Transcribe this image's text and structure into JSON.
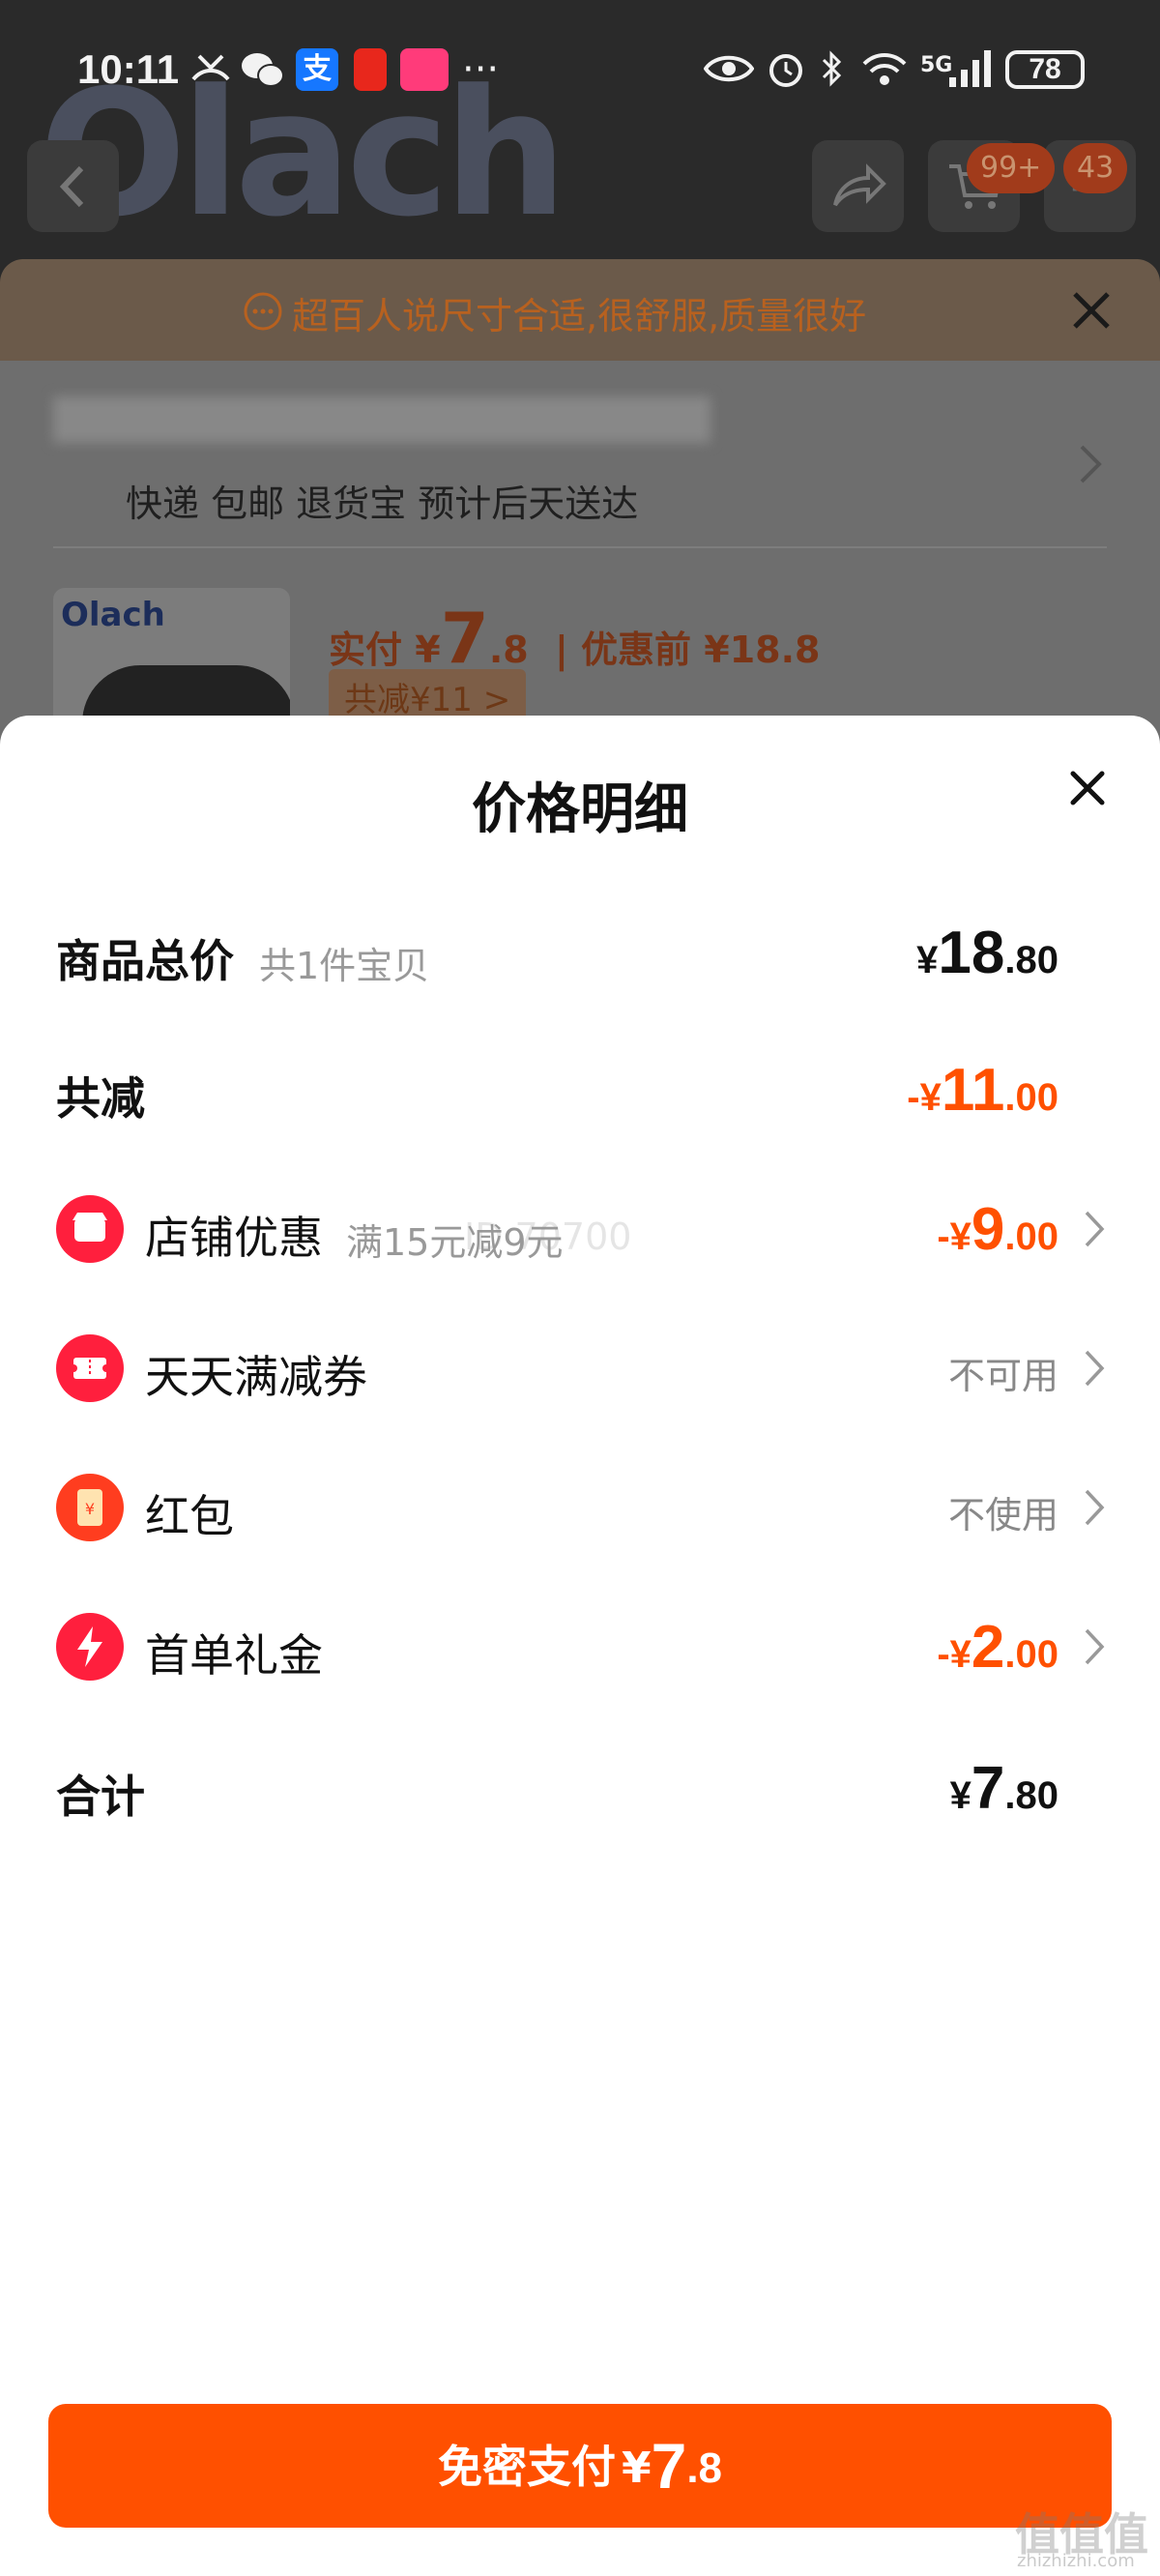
{
  "status_bar": {
    "time": "10:11",
    "battery": "78",
    "network": "5G",
    "icons": [
      "missed-call-icon",
      "wechat-icon",
      "alipay-icon",
      "red-envelope-icon",
      "taobao-icon",
      "more-dots-icon",
      "eye-icon",
      "alarm-icon",
      "bluetooth-icon",
      "wifi-icon",
      "signal-icon"
    ],
    "alipay_glyph": "支"
  },
  "background": {
    "brand_logo": "Olach",
    "cart_badge": "99+",
    "message_badge": "43",
    "tip": "超百人说尺寸合适,很舒服,质量很好",
    "shipping_info": "快递 包邮 退货宝 预计后天送达",
    "product": {
      "brand": "Olach",
      "price_label": "实付",
      "price_currency": "¥",
      "price_int": "7",
      "price_dec": ".8",
      "original_label": "| 优惠前 ¥18.8",
      "saving_tag": "共减¥11 >"
    }
  },
  "sheet": {
    "title": "价格明细",
    "rows": [
      {
        "label": "商品总价",
        "sub": "共1件宝贝",
        "currency": "¥",
        "int": "18",
        "dec": ".80"
      },
      {
        "label": "共减",
        "currency": "-¥",
        "int": "11",
        "dec": ".00"
      },
      {
        "label": "店铺优惠",
        "sub": "满15元减9元",
        "currency": "-¥",
        "int": "9",
        "dec": ".00",
        "icon": "shop-icon"
      },
      {
        "label": "天天满减券",
        "status": "不可用",
        "icon": "coupon-icon"
      },
      {
        "label": "红包",
        "status": "不使用",
        "icon": "red-packet-icon",
        "packet_glyph": "¥"
      },
      {
        "label": "首单礼金",
        "currency": "-¥",
        "int": "2",
        "dec": ".00",
        "icon": "lightning-icon"
      },
      {
        "label": "合计",
        "currency": "¥",
        "int": "7",
        "dec": ".80"
      }
    ]
  },
  "pay_button": {
    "label": "免密支付",
    "currency": "¥",
    "int": "7",
    "dec": ".8"
  },
  "watermarks": {
    "mid": "ID 70700",
    "site": "值值值",
    "site_domain": "zhizhizhi.com"
  },
  "colors": {
    "accent": "#ff5000",
    "icon_red": "#ff1f3d",
    "muted": "#999999"
  }
}
